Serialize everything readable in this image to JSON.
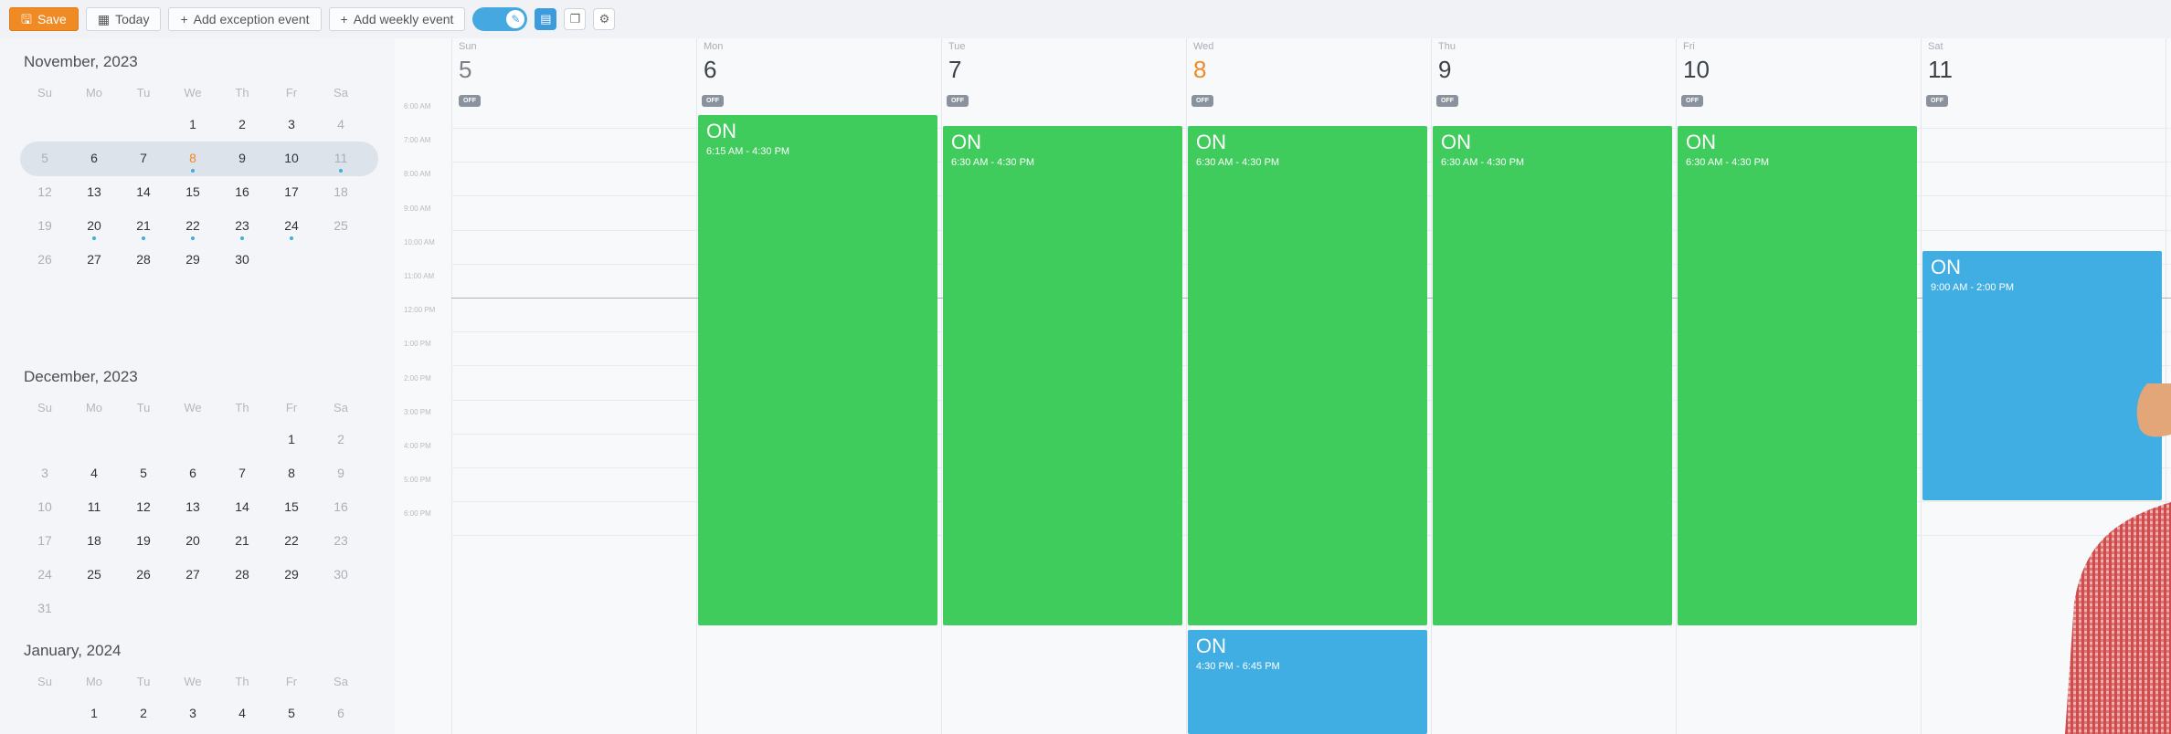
{
  "toolbar": {
    "save": "Save",
    "today": "Today",
    "add_exception": "Add exception event",
    "add_weekly": "Add weekly event",
    "icons": [
      "save-icon",
      "calendar-icon",
      "plus-icon",
      "plus-icon",
      "pencil-icon",
      "calendar-view-icon",
      "copy-icon",
      "gear-icon"
    ]
  },
  "months": [
    {
      "title": "November, 2023",
      "dow": [
        "Su",
        "Mo",
        "Tu",
        "We",
        "Th",
        "Fr",
        "Sa"
      ],
      "weeks": [
        [
          "",
          "",
          "",
          "1",
          "2",
          "3",
          "4"
        ],
        [
          "5",
          "6",
          "7",
          "8",
          "9",
          "10",
          "11"
        ],
        [
          "12",
          "13",
          "14",
          "15",
          "16",
          "17",
          "18"
        ],
        [
          "19",
          "20",
          "21",
          "22",
          "23",
          "24",
          "25"
        ],
        [
          "26",
          "27",
          "28",
          "29",
          "30",
          "",
          ""
        ]
      ]
    },
    {
      "title": "December, 2023",
      "dow": [
        "Su",
        "Mo",
        "Tu",
        "We",
        "Th",
        "Fr",
        "Sa"
      ],
      "weeks": [
        [
          "",
          "",
          "",
          "",
          "",
          "1",
          "2"
        ],
        [
          "3",
          "4",
          "5",
          "6",
          "7",
          "8",
          "9"
        ],
        [
          "10",
          "11",
          "12",
          "13",
          "14",
          "15",
          "16"
        ],
        [
          "17",
          "18",
          "19",
          "20",
          "21",
          "22",
          "23"
        ],
        [
          "24",
          "25",
          "26",
          "27",
          "28",
          "29",
          "30"
        ],
        [
          "31",
          "",
          "",
          "",
          "",
          "",
          ""
        ]
      ]
    },
    {
      "title": "January, 2024",
      "dow": [
        "Su",
        "Mo",
        "Tu",
        "We",
        "Th",
        "Fr",
        "Sa"
      ],
      "weeks": [
        [
          "",
          "1",
          "2",
          "3",
          "4",
          "5",
          "6"
        ]
      ]
    }
  ],
  "days": [
    {
      "name": "Sun",
      "date": "5",
      "off": "OFF"
    },
    {
      "name": "Mon",
      "date": "6",
      "off": "OFF"
    },
    {
      "name": "Tue",
      "date": "7",
      "off": "OFF"
    },
    {
      "name": "Wed",
      "date": "8",
      "off": "OFF"
    },
    {
      "name": "Thu",
      "date": "9",
      "off": "OFF"
    },
    {
      "name": "Fri",
      "date": "10",
      "off": "OFF"
    },
    {
      "name": "Sat",
      "date": "11",
      "off": "OFF"
    }
  ],
  "times": [
    "6:00 AM",
    "7:00 AM",
    "8:00 AM",
    "9:00 AM",
    "10:00 AM",
    "11:00 AM",
    "12:00 PM",
    "1:00 PM",
    "2:00 PM",
    "3:00 PM",
    "4:00 PM",
    "5:00 PM",
    "6:00 PM"
  ],
  "events": [
    {
      "title": "ON",
      "time": "6:15 AM - 4:30 PM"
    },
    {
      "title": "ON",
      "time": "6:30 AM - 4:30 PM"
    },
    {
      "title": "ON",
      "time": "6:30 AM - 4:30 PM"
    },
    {
      "title": "ON",
      "time": "6:30 AM - 4:30 PM"
    },
    {
      "title": "ON",
      "time": "6:30 AM - 4:30 PM"
    },
    {
      "title": "ON",
      "time": "9:00 AM - 2:00 PM"
    },
    {
      "title": "ON",
      "time": "4:30 PM - 6:45 PM"
    }
  ],
  "colors": {
    "accent_orange": "#f08a24",
    "event_green": "#40cc5c",
    "event_blue": "#41aee3"
  }
}
